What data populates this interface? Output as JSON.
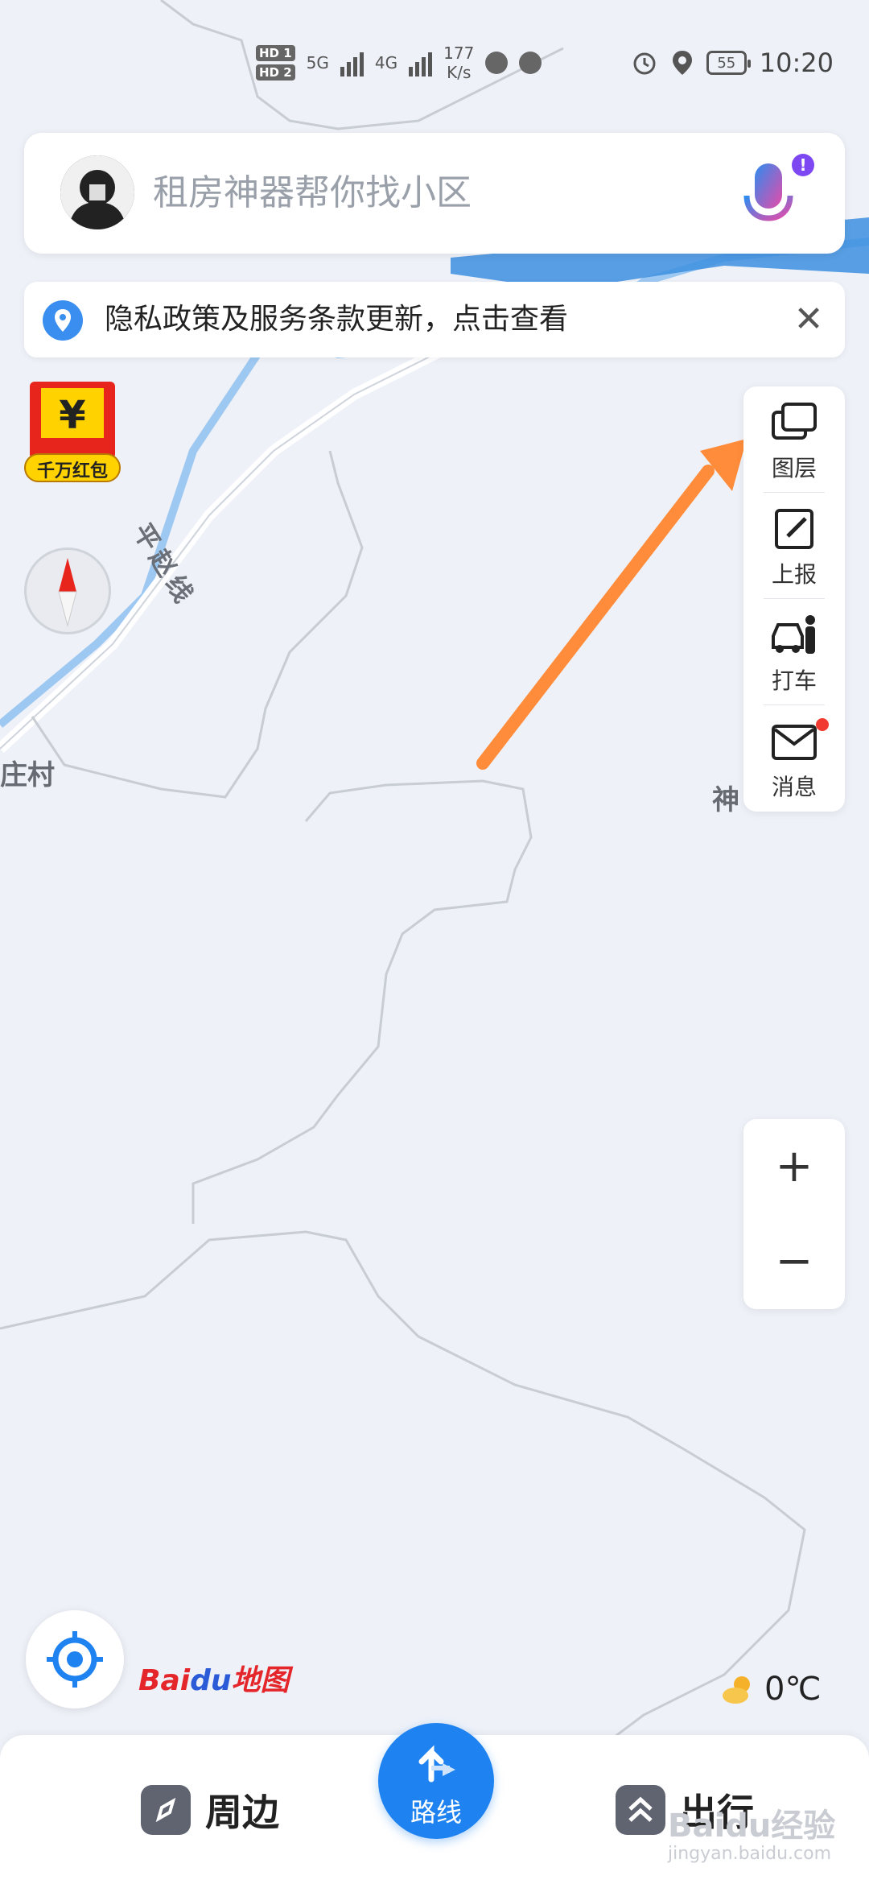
{
  "status_bar": {
    "hd1": "HD 1",
    "hd2": "HD 2",
    "net_5g": "5G",
    "net_4g": "4G",
    "speed_value": "177",
    "speed_unit": "K/s",
    "battery": "55",
    "time": "10:20"
  },
  "search": {
    "placeholder": "租房神器帮你找小区",
    "mic_badge": "!"
  },
  "notice": {
    "text": "隐私政策及服务条款更新，点击查看",
    "close": "✕"
  },
  "red_packet": {
    "symbol": "¥",
    "label": "千万红包"
  },
  "tools": [
    {
      "label": "图层",
      "icon": "layers-icon"
    },
    {
      "label": "上报",
      "icon": "report-icon"
    },
    {
      "label": "打车",
      "icon": "taxi-icon"
    },
    {
      "label": "消息",
      "icon": "mail-icon"
    }
  ],
  "zoom": {
    "in": "+",
    "out": "−"
  },
  "map_labels": {
    "village": "庄村",
    "road": "平赵线",
    "poi_partial": "神"
  },
  "logo": {
    "bai": "Bai",
    "du": "du",
    "ditu": "地图"
  },
  "weather": {
    "temp": "0℃"
  },
  "bottom_nav": {
    "nearby": "周边",
    "route": "路线",
    "travel": "出行"
  },
  "watermark": {
    "main": "Baidu经验",
    "sub": "jingyan.baidu.com"
  },
  "colors": {
    "accent": "#1e82f0",
    "arrow": "#ff8c3a",
    "map_bg": "#eef1f8",
    "river": "#9cc8f2"
  }
}
